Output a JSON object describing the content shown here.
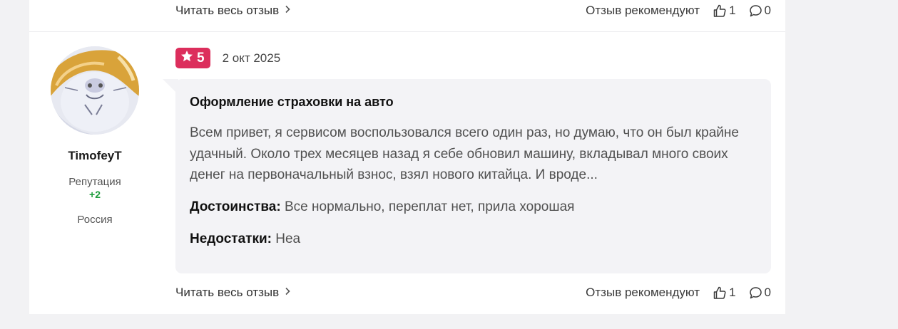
{
  "previous_review": {
    "read_more_label": "Читать весь отзыв",
    "recommend_label": "Отзыв рекомендуют",
    "likes": "1",
    "comments": "0"
  },
  "review": {
    "author": {
      "name": "TimofeyT",
      "reputation_label": "Репутация",
      "reputation_value": "+2",
      "country": "Россия"
    },
    "rating": "5",
    "date": "2 окт 2025",
    "title": "Оформление страховки на авто",
    "text": "Всем привет, я сервисом воспользовался всего один раз, но думаю, что он был крайне удачный. Около трех месяцев назад я себе обновил машину, вкладывал много своих денег на первоначальный взнос, взял нового китайца. И вроде...",
    "pros_label": "Достоинства:",
    "pros": "Все нормально, переплат нет, прила хорошая",
    "cons_label": "Недостатки:",
    "cons": "Неа",
    "read_more_label": "Читать весь отзыв",
    "recommend_label": "Отзыв рекомендуют",
    "likes": "1",
    "comments": "0"
  },
  "colors": {
    "rating_badge": "#dc2e5c",
    "reputation_positive": "#1f9d3d",
    "bubble_background": "#f3f3f6",
    "page_background": "#f2f2f4"
  },
  "icons": {
    "star": "star-icon",
    "chevron": "chevron-right-icon",
    "like": "thumbs-up-icon",
    "comment": "comment-icon"
  }
}
